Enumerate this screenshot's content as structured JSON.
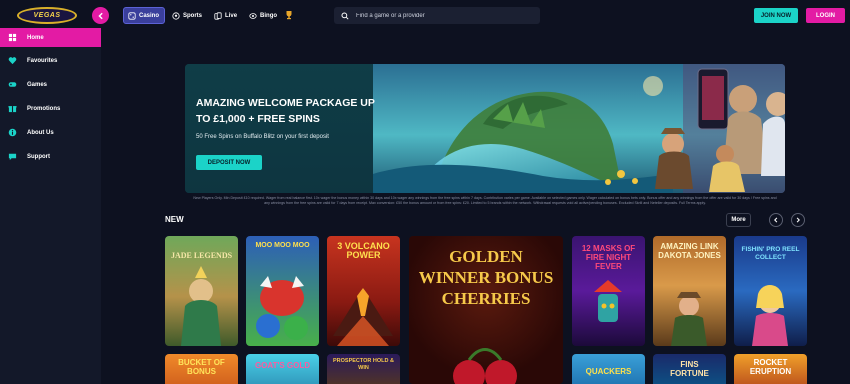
{
  "header": {
    "logo_text": "VEGAS",
    "tabs": [
      {
        "label": "Casino",
        "icon": "dice-icon"
      },
      {
        "label": "Sports",
        "icon": "soccer-ball-icon"
      },
      {
        "label": "Live",
        "icon": "cards-icon"
      },
      {
        "label": "Bingo",
        "icon": "bingo-ball-icon"
      }
    ],
    "search_placeholder": "Find a game or a provider",
    "join_label": "JOIN NOW",
    "login_label": "LOGIN"
  },
  "sidebar": {
    "items": [
      {
        "label": "Home",
        "icon": "home-icon",
        "active": true
      },
      {
        "label": "Favourites",
        "icon": "heart-icon"
      },
      {
        "label": "Games",
        "icon": "gamepad-icon"
      },
      {
        "label": "Promotions",
        "icon": "gift-icon"
      },
      {
        "label": "About Us",
        "icon": "info-icon"
      },
      {
        "label": "Support",
        "icon": "chat-icon"
      }
    ]
  },
  "hero": {
    "title_line1": "AMAZING WELCOME PACKAGE UP",
    "title_line2": "TO £1,000 + FREE SPINS",
    "subtitle": "50 Free Spins on Buffalo Blitz on your first deposit",
    "cta_label": "DEPOSIT NOW"
  },
  "terms_text": "New Players Only. Min Deposit £10 required. Wager from real balance first. 10x wager the bonus money within 30 days and 10x wager any winnings from the free spins within 7 days. Contribution varies per game. Available on selected games only. Wager calculated on bonus bets only. Bonus offer and any winnings from the offer are valid for 30 days / Free spins and any winnings from the free spins are valid for 7 days from receipt. Max conversion: £50 the bonus amount or from free spins: £20. Limited to 5 brands within the network. Withdrawal requests void all active/pending bonuses. Excluded Skrill and Neteller deposits. Full Terms apply.",
  "new_section": {
    "title": "NEW",
    "more_label": "More",
    "games": [
      {
        "name": "JADE LEGENDS"
      },
      {
        "name": "MOO MOO MOO"
      },
      {
        "name": "3 VOLCANO POWER"
      },
      {
        "name": "GOLDEN WINNER BONUS CHERRIES"
      },
      {
        "name": "12 MASKS OF FIRE NIGHT FEVER"
      },
      {
        "name": "AMAZING LINK DAKOTA JONES"
      },
      {
        "name": "FISHIN' PRO REEL COLLECT"
      },
      {
        "name": "BUCKET OF BONUS"
      },
      {
        "name": "GOAT'S GOLD"
      },
      {
        "name": "PROSPECTOR HOLD & WIN"
      },
      {
        "name": "QUACKERS"
      },
      {
        "name": "FINS FORTUNE"
      },
      {
        "name": "ROCKET ERUPTION"
      }
    ]
  }
}
